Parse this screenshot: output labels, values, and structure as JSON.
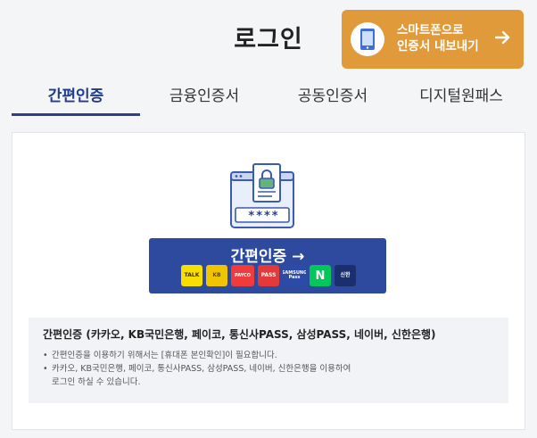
{
  "header": {
    "title": "로그인",
    "smartphone_button": {
      "line1": "스마트폰으로",
      "line2": "인증서 내보내기",
      "icon": "phone-icon",
      "arrow_icon": "arrow-right-icon",
      "color": "#e09a3a"
    }
  },
  "tabs": [
    {
      "label": "간편인증",
      "active": true
    },
    {
      "label": "금융인증서",
      "active": false
    },
    {
      "label": "공동인증서",
      "active": false
    },
    {
      "label": "디지털원패스",
      "active": false
    }
  ],
  "panel": {
    "illustration_icon": "certificate-lock-icon",
    "password_mask": "****",
    "simple_auth_button": {
      "label": "간편인증 →",
      "color": "#2e4a9e",
      "providers": [
        {
          "name": "kakao",
          "text": "TALK"
        },
        {
          "name": "kb",
          "text": "KB"
        },
        {
          "name": "payco",
          "text": "PAYCO"
        },
        {
          "name": "pass",
          "text": "PASS"
        },
        {
          "name": "samsung-pass",
          "text": "SAMSUNG Pass"
        },
        {
          "name": "naver",
          "text": "N"
        },
        {
          "name": "shinhan",
          "text": "신한"
        }
      ]
    },
    "info": {
      "title": "간편인증 (카카오, KB국민은행, 페이코, 통신사PASS, 삼성PASS, 네이버, 신한은행)",
      "line1": "간편인증을 이용하기 위해서는 [휴대폰 본인확인]이 필요합니다.",
      "line2": "카카오, KB국민은행, 페이코, 통신사PASS, 삼성PASS, 네이버, 신한은행을 이용하여",
      "line3": "로그인 하실 수 있습니다."
    }
  },
  "colors": {
    "accent": "#2c3f8f",
    "active_tab_text": "#1f3b8a"
  }
}
